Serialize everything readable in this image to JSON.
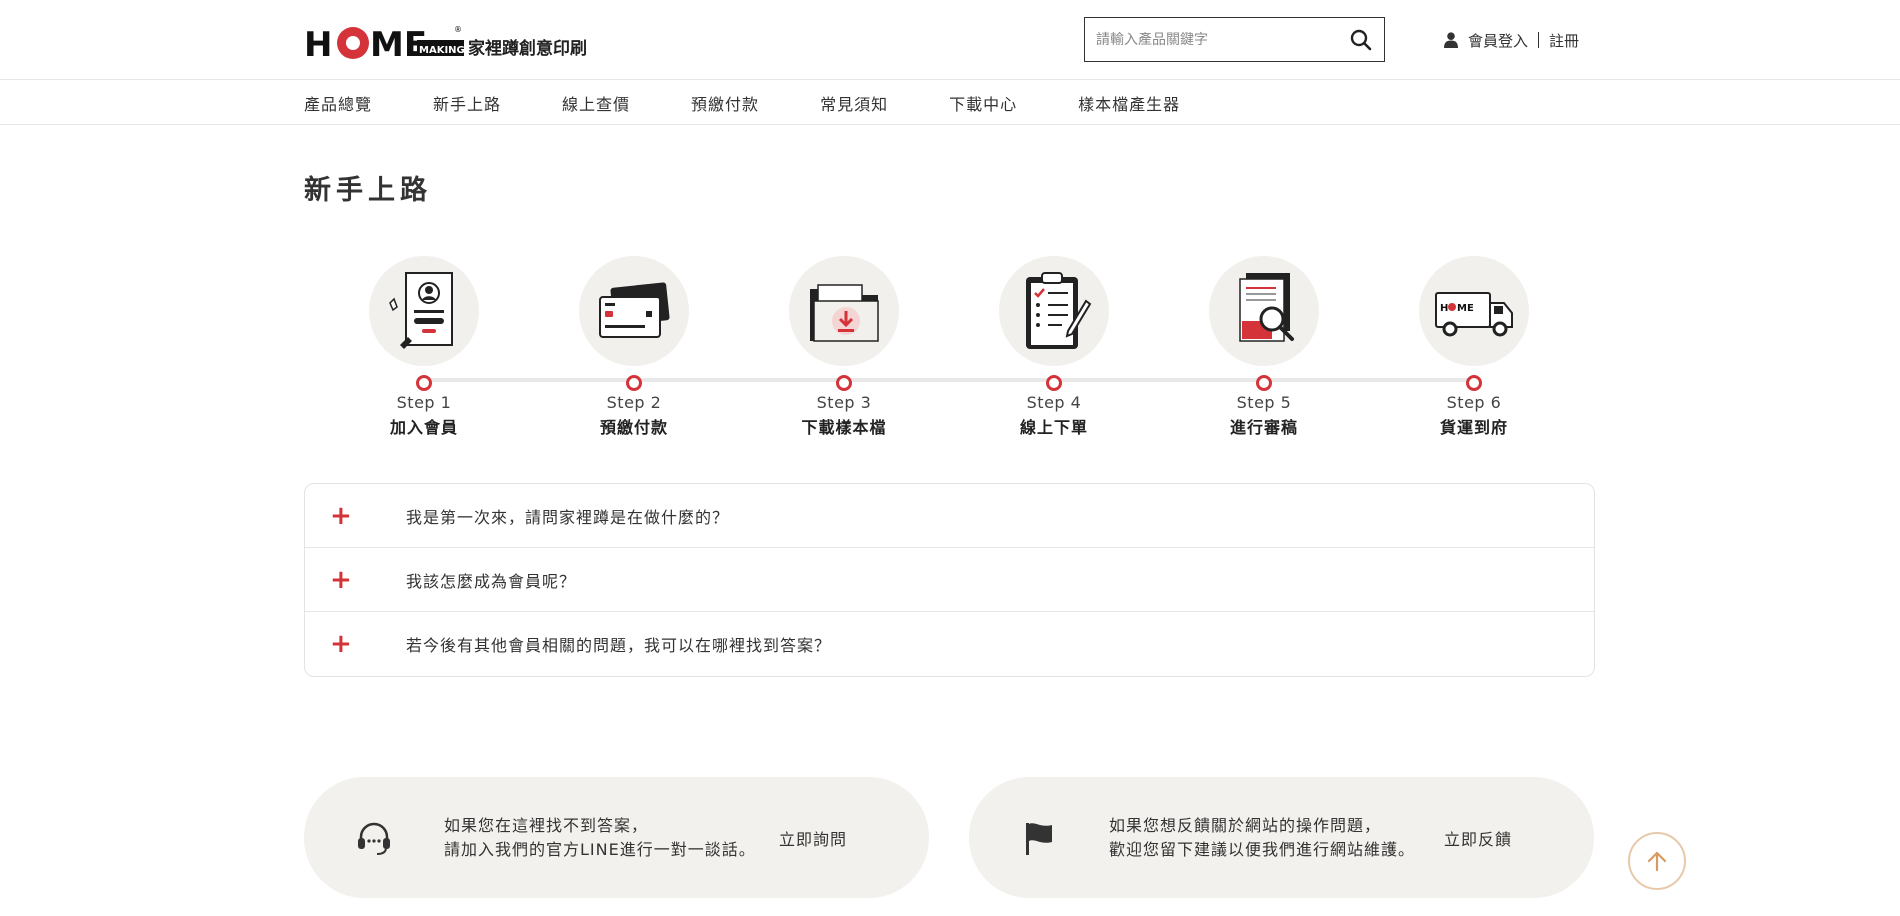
{
  "header": {
    "logo_text": "家裡蹲創意印刷",
    "logo_brand": "HOME",
    "logo_sub": "MAKING",
    "search_placeholder": "請輸入產品關鍵字",
    "search_icon": "search-icon",
    "member_icon": "user-icon",
    "login_label": "會員登入",
    "register_label": "註冊"
  },
  "nav": {
    "items": [
      "產品總覽",
      "新手上路",
      "線上查價",
      "預繳付款",
      "常見須知",
      "下載中心",
      "樣本檔產生器"
    ]
  },
  "page": {
    "title": "新手上路"
  },
  "steps": [
    {
      "num": "Step 1",
      "name": "加入會員",
      "icon": "member-card-icon"
    },
    {
      "num": "Step 2",
      "name": "預繳付款",
      "icon": "credit-card-icon"
    },
    {
      "num": "Step 3",
      "name": "下載樣本檔",
      "icon": "download-folder-icon"
    },
    {
      "num": "Step 4",
      "name": "線上下單",
      "icon": "clipboard-checklist-icon"
    },
    {
      "num": "Step 5",
      "name": "進行審稿",
      "icon": "document-review-icon"
    },
    {
      "num": "Step 6",
      "name": "貨運到府",
      "icon": "delivery-truck-icon"
    }
  ],
  "faq": [
    {
      "q": "我是第一次來，請問家裡蹲是在做什麼的？",
      "icon": "plus-icon"
    },
    {
      "q": "我該怎麼成為會員呢？",
      "icon": "plus-icon"
    },
    {
      "q": "若今後有其他會員相關的問題，我可以在哪裡找到答案？",
      "icon": "plus-icon"
    }
  ],
  "cards": [
    {
      "line1": "如果您在這裡找不到答案，",
      "line2": "請加入我們的官方LINE進行一對一談話。",
      "link": "立即詢問",
      "icon": "headset-icon"
    },
    {
      "line1": "如果您想反饋關於網站的操作問題，",
      "line2": "歡迎您留下建議以便我們進行網站維護。",
      "link": "立即反饋",
      "icon": "flag-icon"
    }
  ],
  "back_to_top_icon": "arrow-up-icon",
  "colors": {
    "accent": "#d4333a",
    "card_bg": "#f3f1ed",
    "back_top_border": "#e7c9a9"
  }
}
